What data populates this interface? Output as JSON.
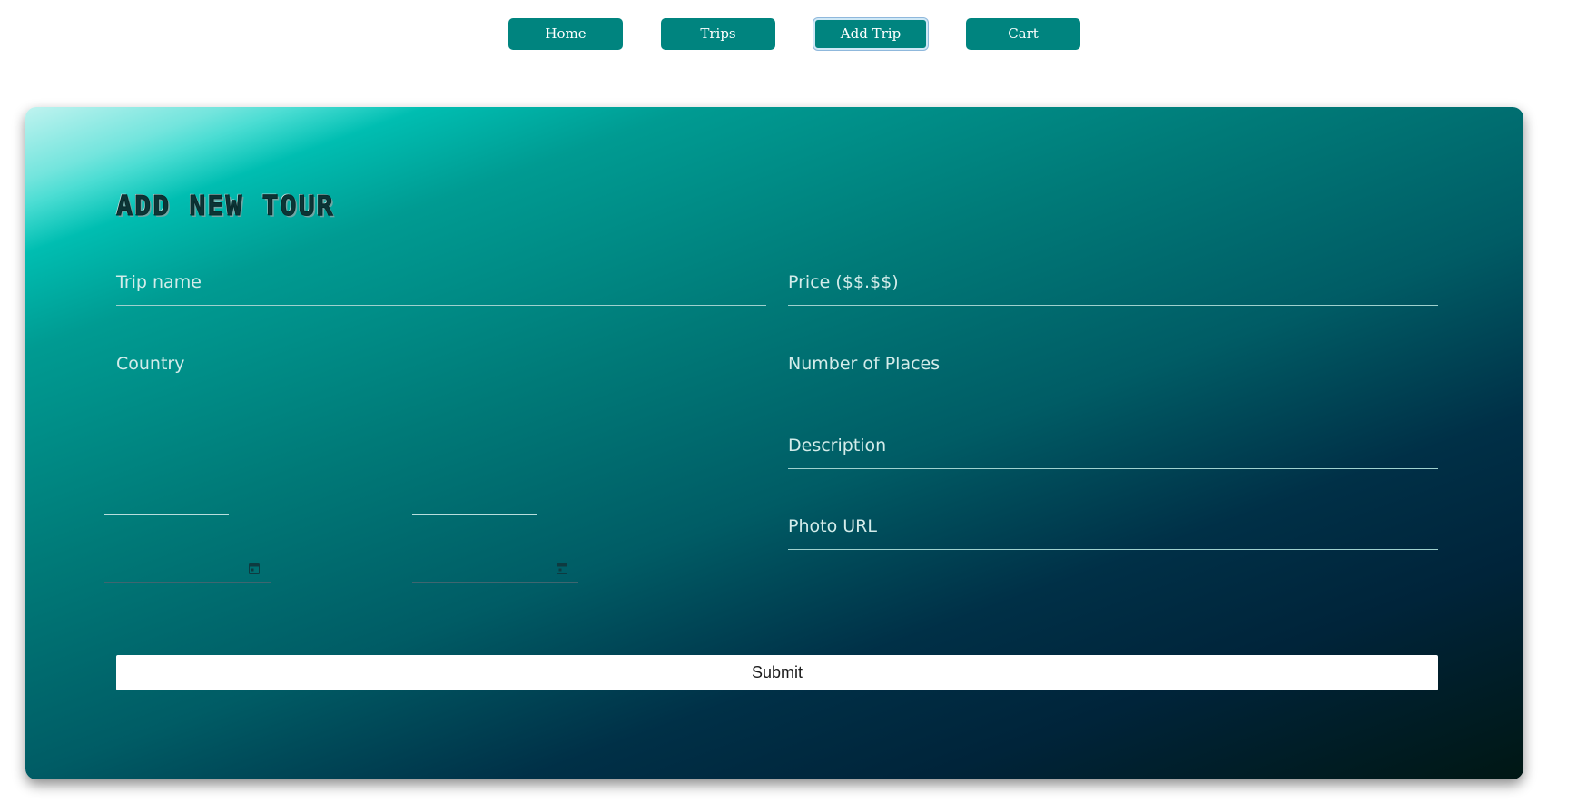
{
  "nav": {
    "items": [
      {
        "label": "Home",
        "active": false
      },
      {
        "label": "Trips",
        "active": false
      },
      {
        "label": "Add Trip",
        "active": true
      },
      {
        "label": "Cart",
        "active": false
      }
    ],
    "accent_color": "#00847f"
  },
  "form": {
    "title": "Add New Tour",
    "fields": {
      "trip_name": {
        "placeholder": "Trip name",
        "value": ""
      },
      "price": {
        "placeholder": "Price ($$.$$)",
        "value": ""
      },
      "country": {
        "placeholder": "Country",
        "value": ""
      },
      "places": {
        "placeholder": "Number of Places",
        "value": ""
      },
      "description": {
        "placeholder": "Description",
        "value": ""
      },
      "photo_url": {
        "placeholder": "Photo URL",
        "value": ""
      }
    },
    "start_date": {
      "value": "",
      "icon": "calendar-icon"
    },
    "end_date": {
      "value": "",
      "icon": "calendar-icon"
    },
    "submit_label": "Submit"
  }
}
